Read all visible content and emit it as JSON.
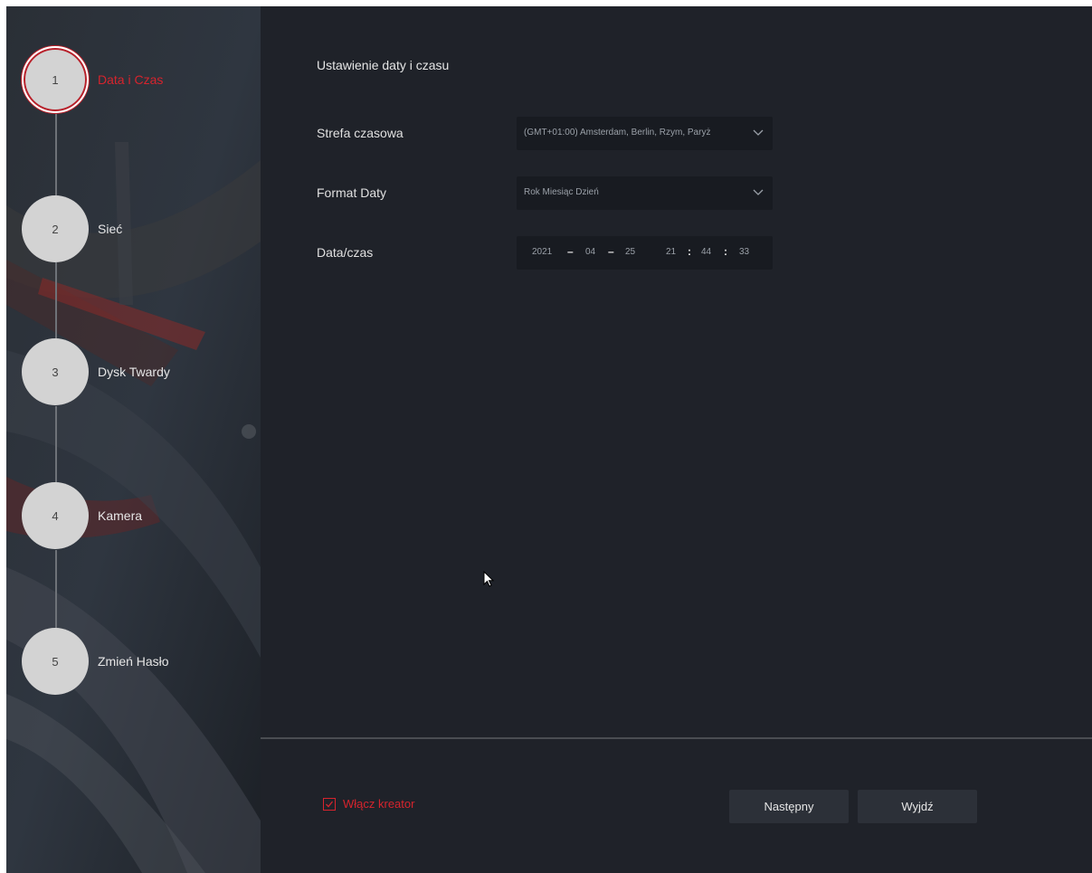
{
  "steps": [
    {
      "number": "1",
      "label": "Data i Czas",
      "active": true
    },
    {
      "number": "2",
      "label": "Sieć",
      "active": false
    },
    {
      "number": "3",
      "label": "Dysk Twardy",
      "active": false
    },
    {
      "number": "4",
      "label": "Kamera",
      "active": false
    },
    {
      "number": "5",
      "label": "Zmień Hasło",
      "active": false
    }
  ],
  "main": {
    "title": "Ustawienie daty i czasu",
    "timezone": {
      "label": "Strefa czasowa",
      "value": "(GMT+01:00) Amsterdam, Berlin, Rzym, Paryż"
    },
    "date_format": {
      "label": "Format Daty",
      "value": "Rok Miesiąc Dzień"
    },
    "datetime": {
      "label": "Data/czas",
      "year": "2021",
      "month": "04",
      "day": "25",
      "hour": "21",
      "minute": "44",
      "second": "33",
      "date_sep": "–",
      "time_sep": ":"
    }
  },
  "footer": {
    "enable_wizard_label": "Włącz kreator",
    "enable_wizard_checked": true,
    "next_label": "Następny",
    "exit_label": "Wyjdź"
  },
  "colors": {
    "accent": "#d6242d",
    "panel_bg": "#1f2229",
    "field_bg": "#181b21",
    "button_bg": "#2c3038"
  },
  "icons": {
    "dropdown": "chevron-down-icon",
    "checkbox": "checkmark-icon",
    "pointer": "mouse-cursor-icon"
  }
}
